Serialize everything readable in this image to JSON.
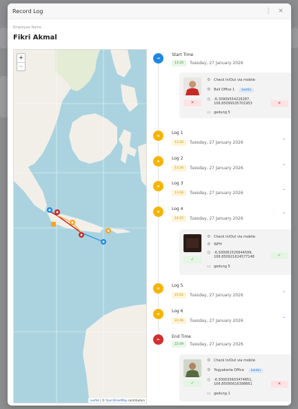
{
  "modal": {
    "title": "Record Log",
    "more_glyph": "⋮",
    "close_glyph": "×"
  },
  "employee": {
    "label": "Employee Name",
    "name": "Fikri Akmal"
  },
  "map": {
    "zoom_in": "+",
    "zoom_out": "−",
    "attribution": {
      "leaflet": "Leaflet",
      "separator": " | © ",
      "osm": "OpenStreetMap",
      "suffix": " contributors"
    },
    "colors": {
      "sea": "#aad3df",
      "land": "#f2efe9",
      "route_red": "#c62828",
      "route_blue": "#1e88e5",
      "route_orange": "#f5a623"
    }
  },
  "timeline": {
    "start": {
      "title": "Start Time",
      "time": "13:26",
      "date": "Tuesday, 27 January 2026",
      "card": {
        "method": "Check In/Out via mobile",
        "office": "Bali Office 1",
        "office_tag": "kantin",
        "coords": "-6.30909554226287, 106.85099105701953",
        "note": "gedung 5",
        "status_left": "✕",
        "status_right": "✕"
      }
    },
    "logs": [
      {
        "title": "Log 1",
        "time": "13:26",
        "date": "Tuesday, 27 January 2026",
        "chevron": "⌄"
      },
      {
        "title": "Log 2",
        "time": "13:26",
        "date": "Tuesday, 27 January 2026",
        "chevron": "⌄"
      },
      {
        "title": "Log 3",
        "time": "13:26",
        "date": "Tuesday, 27 January 2026",
        "chevron": "⌄"
      },
      {
        "title": "Log 4",
        "time": "14:25",
        "date": "Tuesday, 27 January 2026",
        "chevron": "⌃"
      },
      {
        "title": "Log 5",
        "time": "15:02",
        "date": "Tuesday, 27 January 2026",
        "chevron": "⌄"
      },
      {
        "title": "Log 6",
        "time": "22:46",
        "date": "Tuesday, 27 January 2026",
        "chevron": "⌄"
      }
    ],
    "log4_card": {
      "method": "Check In/Out via mobile",
      "office": "WFH",
      "coords": "-6.500061520644599, 106.850921624577148",
      "note": "gedung 5",
      "status_left": "✓",
      "status_right": "✓"
    },
    "end": {
      "title": "End Time",
      "time": "22:49",
      "date": "Tuesday, 27 January 2026",
      "card": {
        "method": "Check In/Out via mobile",
        "office": "Yogyakarta Office",
        "office_tag": "kantin",
        "coords": "-6.500035603474851, 106.85095616398661",
        "note": "gedung 1",
        "status_left": "✓",
        "status_right": "✕"
      }
    },
    "node_glyphs": {
      "start": "⇥",
      "log": "≋",
      "end": "⇤"
    }
  }
}
